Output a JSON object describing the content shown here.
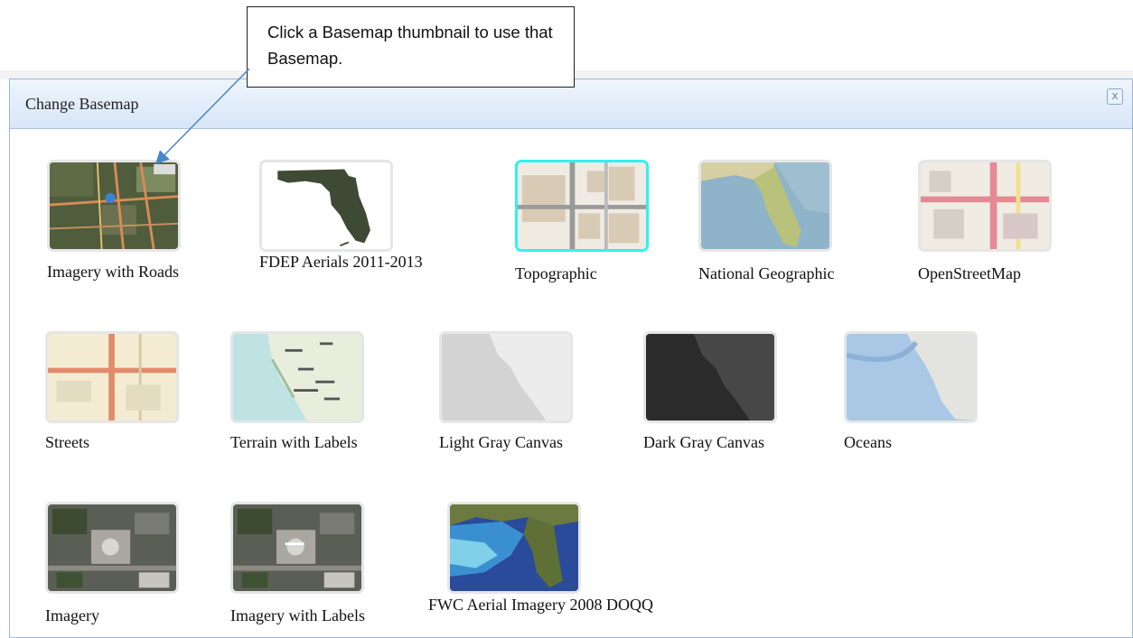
{
  "callout": {
    "text": "Click a Basemap thumbnail to use that Basemap."
  },
  "dialog": {
    "title": "Change Basemap",
    "close_label": "x"
  },
  "basemaps": [
    {
      "label": "Imagery with Roads",
      "icon": "imagery-roads-thumbnail"
    },
    {
      "label": "FDEP Aerials 2011-2013",
      "icon": "fdep-aerials-thumbnail"
    },
    {
      "label": "Topographic",
      "icon": "topographic-thumbnail",
      "selected": true
    },
    {
      "label": "National Geographic",
      "icon": "national-geographic-thumbnail"
    },
    {
      "label": "OpenStreetMap",
      "icon": "openstreetmap-thumbnail"
    },
    {
      "label": "Streets",
      "icon": "streets-thumbnail"
    },
    {
      "label": "Terrain with Labels",
      "icon": "terrain-labels-thumbnail"
    },
    {
      "label": "Light Gray Canvas",
      "icon": "light-gray-canvas-thumbnail"
    },
    {
      "label": "Dark Gray Canvas",
      "icon": "dark-gray-canvas-thumbnail"
    },
    {
      "label": "Oceans",
      "icon": "oceans-thumbnail"
    },
    {
      "label": "Imagery",
      "icon": "imagery-thumbnail"
    },
    {
      "label": "Imagery with Labels",
      "icon": "imagery-labels-thumbnail"
    },
    {
      "label": "FWC Aerial Imagery 2008 DOQQ",
      "icon": "fwc-aerial-thumbnail"
    }
  ],
  "colors": {
    "selected_border": "#2ef2f2",
    "titlebar": "#d7e6f7",
    "arrow": "#4a86c8"
  }
}
